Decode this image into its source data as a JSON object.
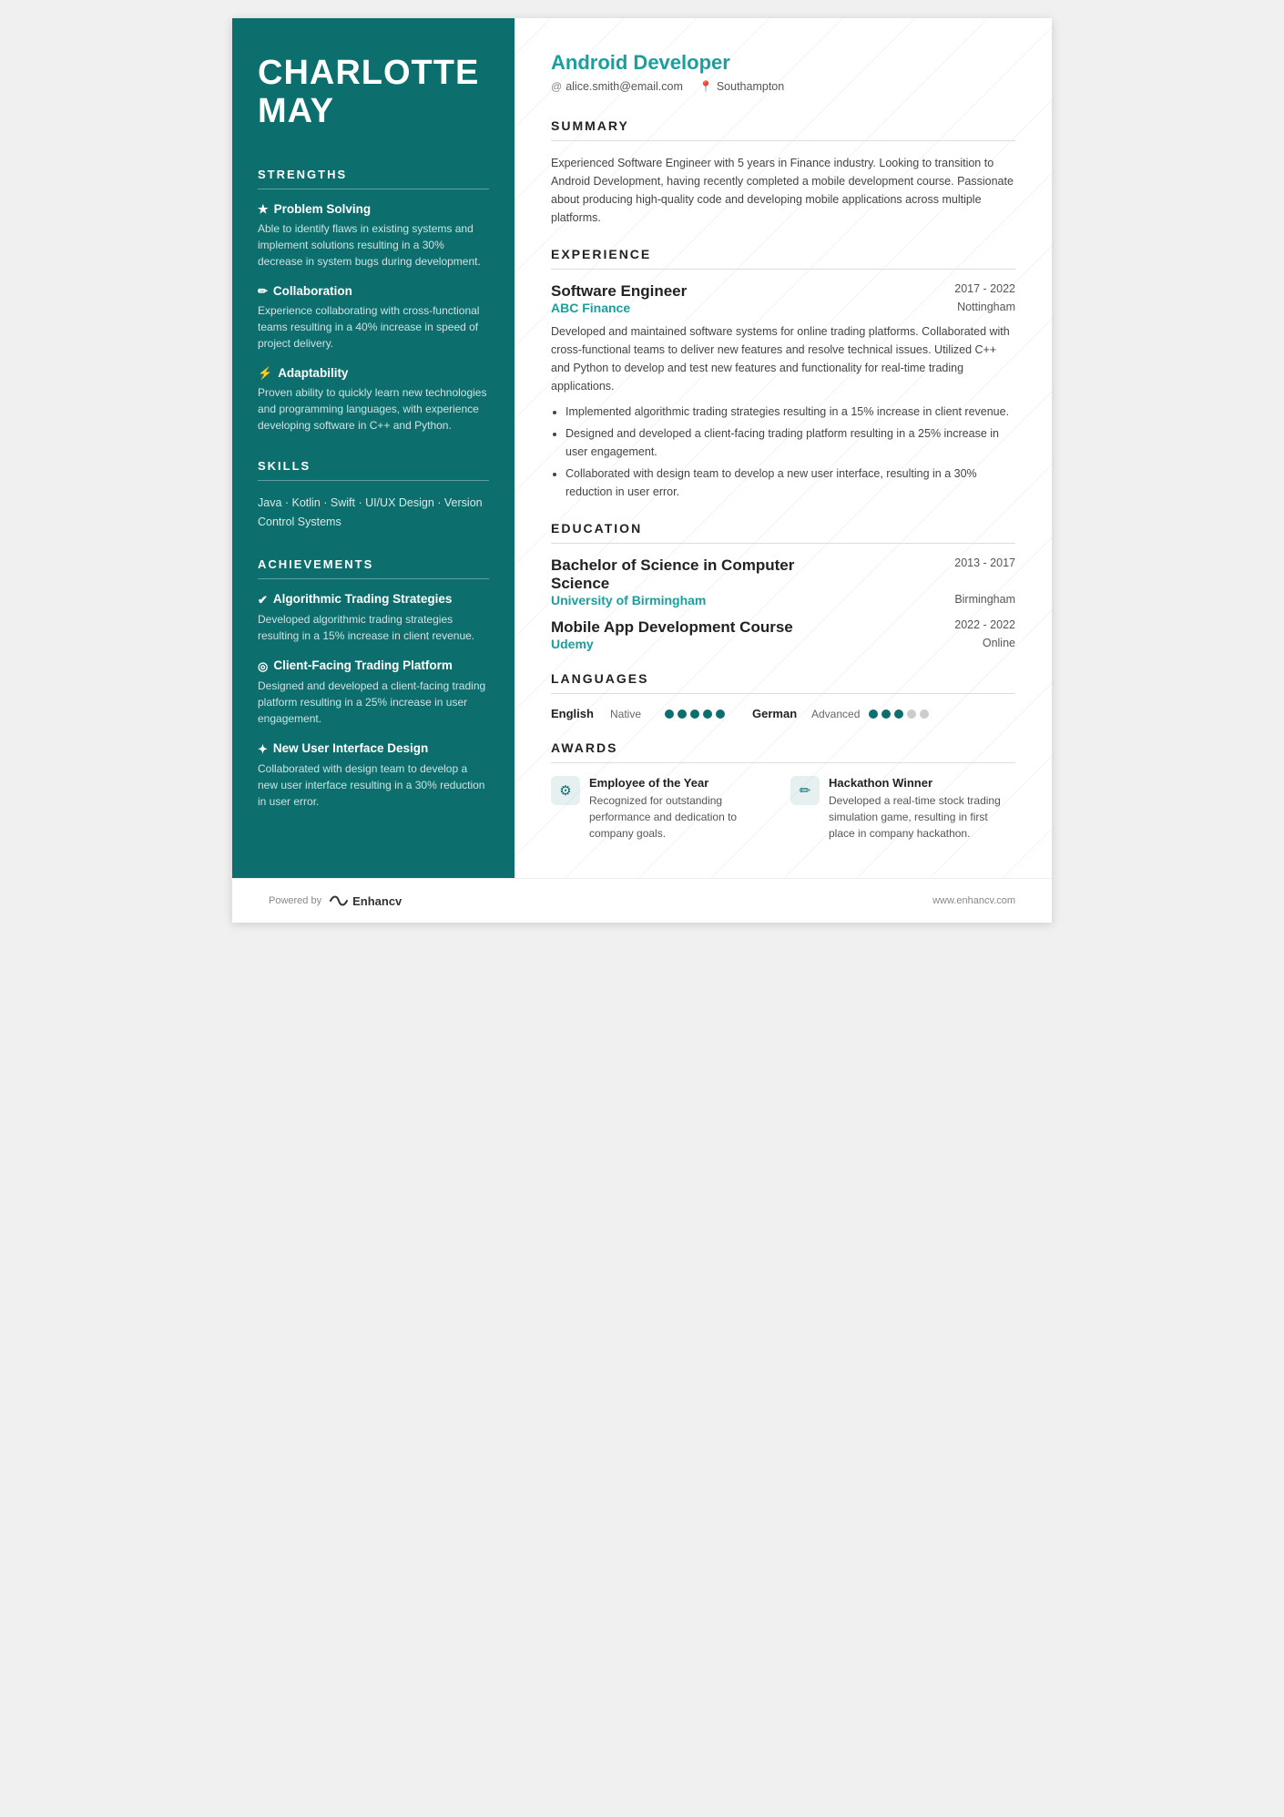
{
  "sidebar": {
    "name": "CHARLOTTE\nMAY",
    "sections": {
      "strengths": {
        "title": "STRENGTHS",
        "items": [
          {
            "icon": "★",
            "title": "Problem Solving",
            "desc": "Able to identify flaws in existing systems and implement solutions resulting in a 30% decrease in system bugs during development."
          },
          {
            "icon": "✏",
            "title": "Collaboration",
            "desc": "Experience collaborating with cross-functional teams resulting in a 40% increase in speed of project delivery."
          },
          {
            "icon": "⚡",
            "title": "Adaptability",
            "desc": "Proven ability to quickly learn new technologies and programming languages, with experience developing software in C++ and Python."
          }
        ]
      },
      "skills": {
        "title": "SKILLS",
        "text": "Java · Kotlin · Swift · UI/UX Design · Version Control Systems"
      },
      "achievements": {
        "title": "ACHIEVEMENTS",
        "items": [
          {
            "icon": "✔",
            "title": "Algorithmic Trading Strategies",
            "desc": "Developed algorithmic trading strategies resulting in a 15% increase in client revenue."
          },
          {
            "icon": "◎",
            "title": "Client-Facing Trading Platform",
            "desc": "Designed and developed a client-facing trading platform resulting in a 25% increase in user engagement."
          },
          {
            "icon": "✦",
            "title": "New User Interface Design",
            "desc": "Collaborated with design team to develop a new user interface resulting in a 30% reduction in user error."
          }
        ]
      }
    }
  },
  "main": {
    "job_title": "Android Developer",
    "contact": {
      "email": "alice.smith@email.com",
      "location": "Southampton"
    },
    "summary": {
      "title": "SUMMARY",
      "text": "Experienced Software Engineer with 5 years in Finance industry. Looking to transition to Android Development, having recently completed a mobile development course. Passionate about producing high-quality code and developing mobile applications across multiple platforms."
    },
    "experience": {
      "title": "EXPERIENCE",
      "jobs": [
        {
          "title": "Software Engineer",
          "dates": "2017 - 2022",
          "company": "ABC Finance",
          "location": "Nottingham",
          "desc": "Developed and maintained software systems for online trading platforms. Collaborated with cross-functional teams to deliver new features and resolve technical issues. Utilized C++ and Python to develop and test new features and functionality for real-time trading applications.",
          "bullets": [
            "Implemented algorithmic trading strategies resulting in a 15% increase in client revenue.",
            "Designed and developed a client-facing trading platform resulting in a 25% increase in user engagement.",
            "Collaborated with design team to develop a new user interface, resulting in a 30% reduction in user error."
          ]
        }
      ]
    },
    "education": {
      "title": "EDUCATION",
      "items": [
        {
          "degree": "Bachelor of Science in Computer Science",
          "dates": "2013 - 2017",
          "institution": "University of Birmingham",
          "location": "Birmingham"
        },
        {
          "degree": "Mobile App Development Course",
          "dates": "2022 - 2022",
          "institution": "Udemy",
          "location": "Online"
        }
      ]
    },
    "languages": {
      "title": "LANGUAGES",
      "items": [
        {
          "name": "English",
          "level": "Native",
          "filled": 5,
          "total": 5
        },
        {
          "name": "German",
          "level": "Advanced",
          "filled": 3,
          "total": 5
        }
      ]
    },
    "awards": {
      "title": "AWARDS",
      "items": [
        {
          "icon": "⚙",
          "title": "Employee of the Year",
          "desc": "Recognized for outstanding performance and dedication to company goals."
        },
        {
          "icon": "✏",
          "title": "Hackathon Winner",
          "desc": "Developed a real-time stock trading simulation game, resulting in first place in company hackathon."
        }
      ]
    }
  },
  "footer": {
    "powered_by": "Powered by",
    "brand": "Enhancv",
    "url": "www.enhancv.com"
  }
}
